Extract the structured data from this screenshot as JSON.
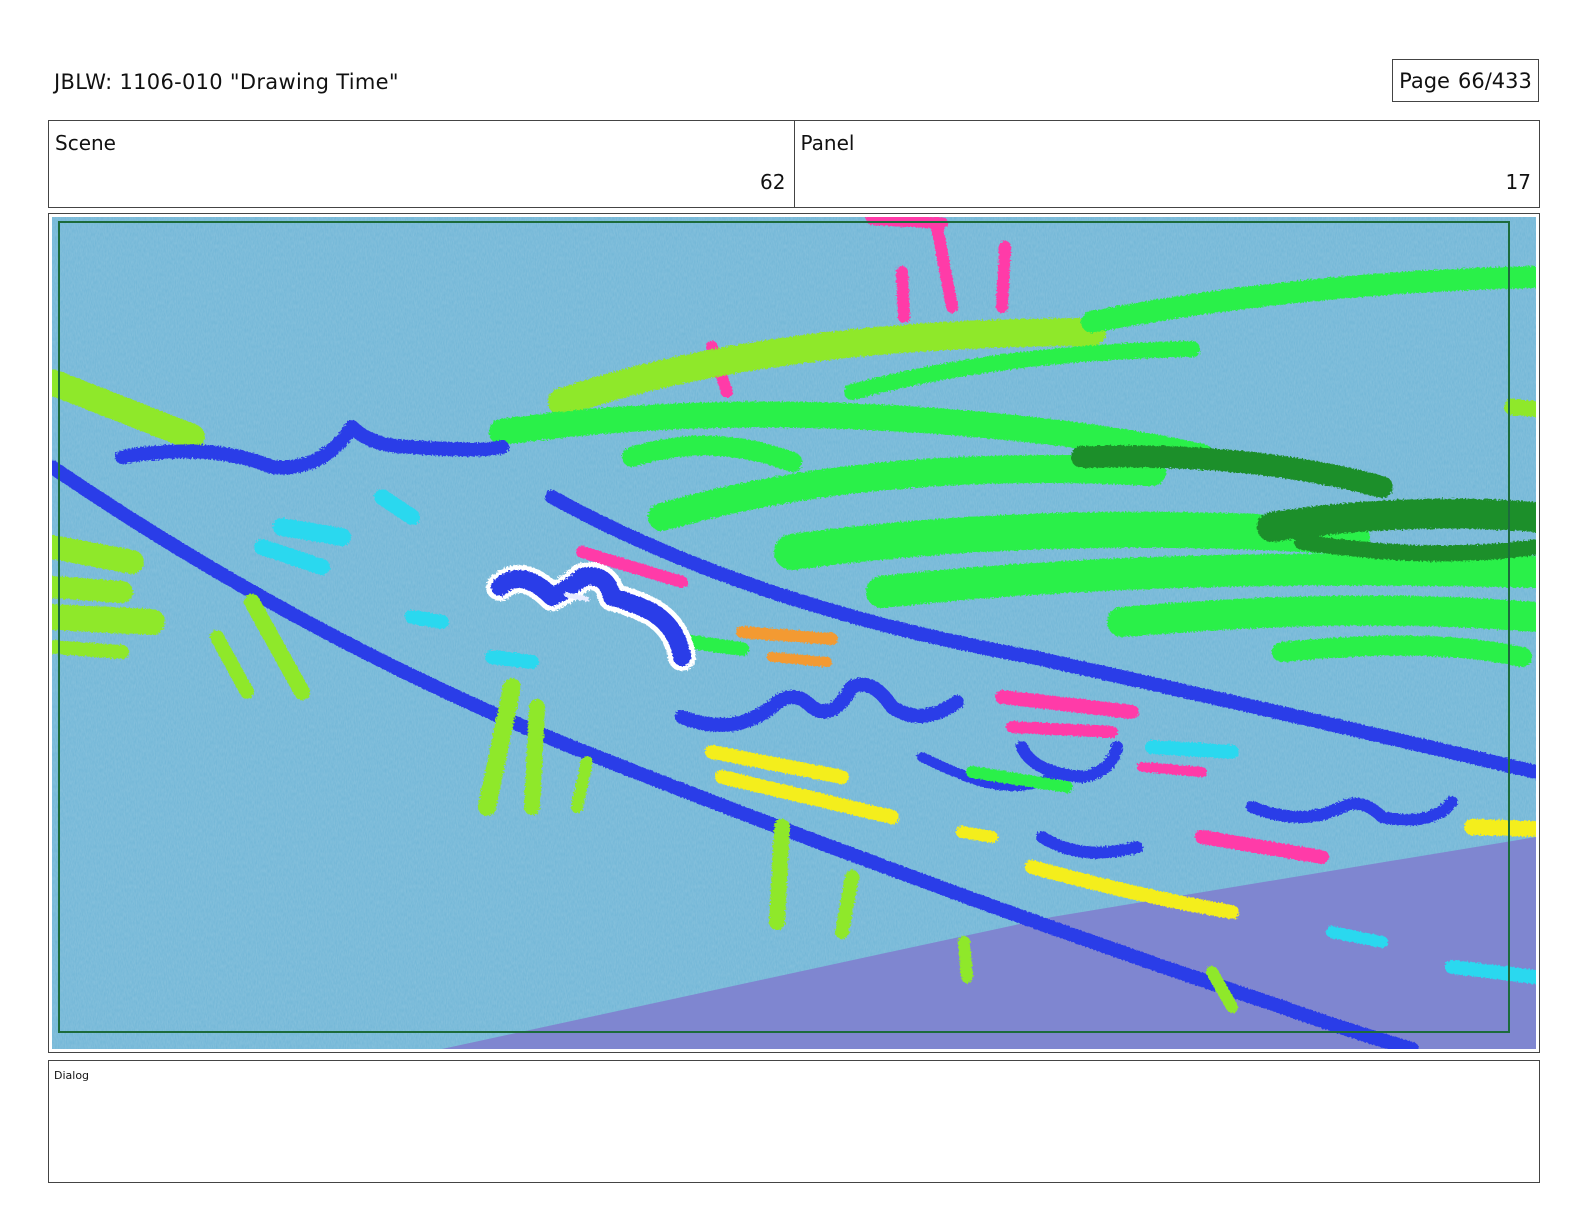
{
  "header": {
    "title": "JBLW: 1106-010 \"Drawing Time\"",
    "page_label": "Page",
    "page_value": "66/433"
  },
  "scene": {
    "label": "Scene",
    "value": "62"
  },
  "panel": {
    "label": "Panel",
    "value": "17"
  },
  "dialog": {
    "label": "Dialog",
    "text": ""
  },
  "colors": {
    "paper": "#6fb5d6",
    "purple_ground": "#7f86d0",
    "blue_stroke": "#2b3ee8",
    "lime_stroke": "#8fe82c",
    "green_stroke": "#2bf04a",
    "dark_green_stroke": "#1e8f2a",
    "pink_stroke": "#ff3aa8",
    "cyan_stroke": "#2ad8ef",
    "yellow_stroke": "#f4ee1c",
    "orange_stroke": "#f39a32",
    "frame_green": "#1c6b3c"
  }
}
